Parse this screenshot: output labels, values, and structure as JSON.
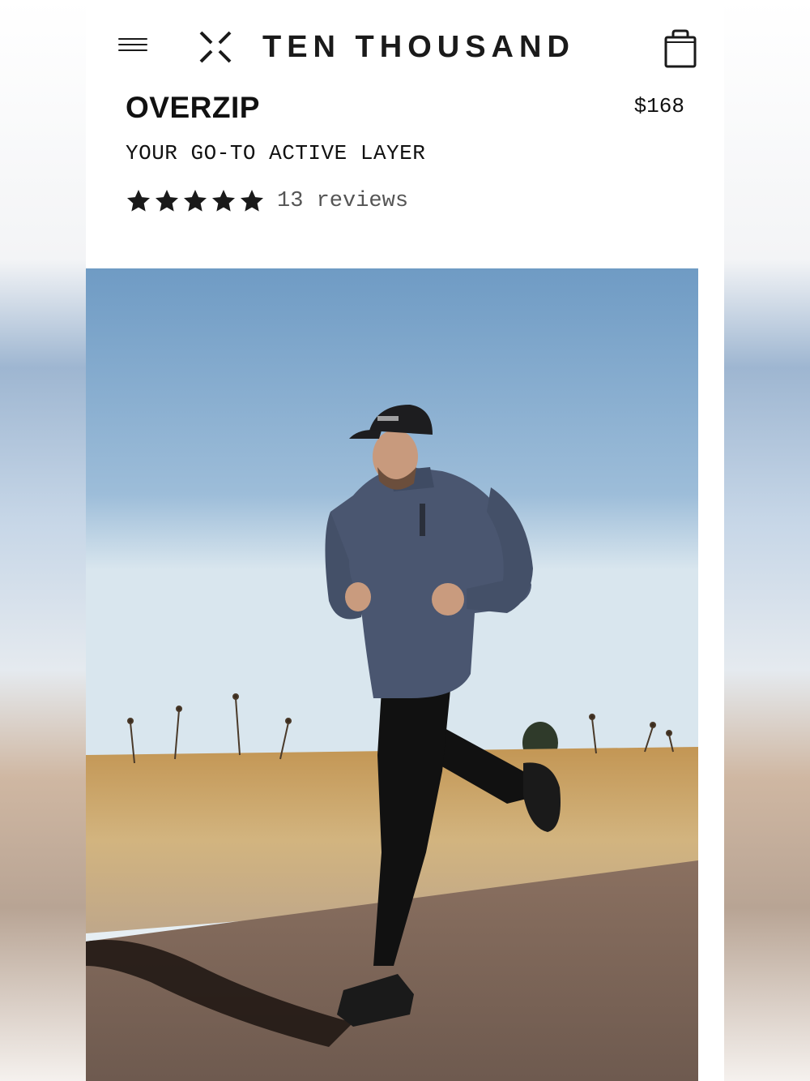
{
  "header": {
    "menu_icon": "hamburger-menu-icon",
    "brand_mark_icon": "ten-thousand-x-logo-icon",
    "brand_name": "TEN THOUSAND",
    "cart_icon": "shopping-bag-icon"
  },
  "product": {
    "name": "OVERZIP",
    "price": "$168",
    "tagline": "YOUR GO-TO ACTIVE LAYER",
    "rating": {
      "stars": 5,
      "max_stars": 5,
      "reviews_text": "13 reviews"
    }
  },
  "hero": {
    "image_icon": "runner-photo"
  },
  "colors": {
    "text": "#111111",
    "muted": "#555555",
    "sky": "#8fb2d2",
    "grass": "#c79f62",
    "ground": "#7a6457"
  }
}
